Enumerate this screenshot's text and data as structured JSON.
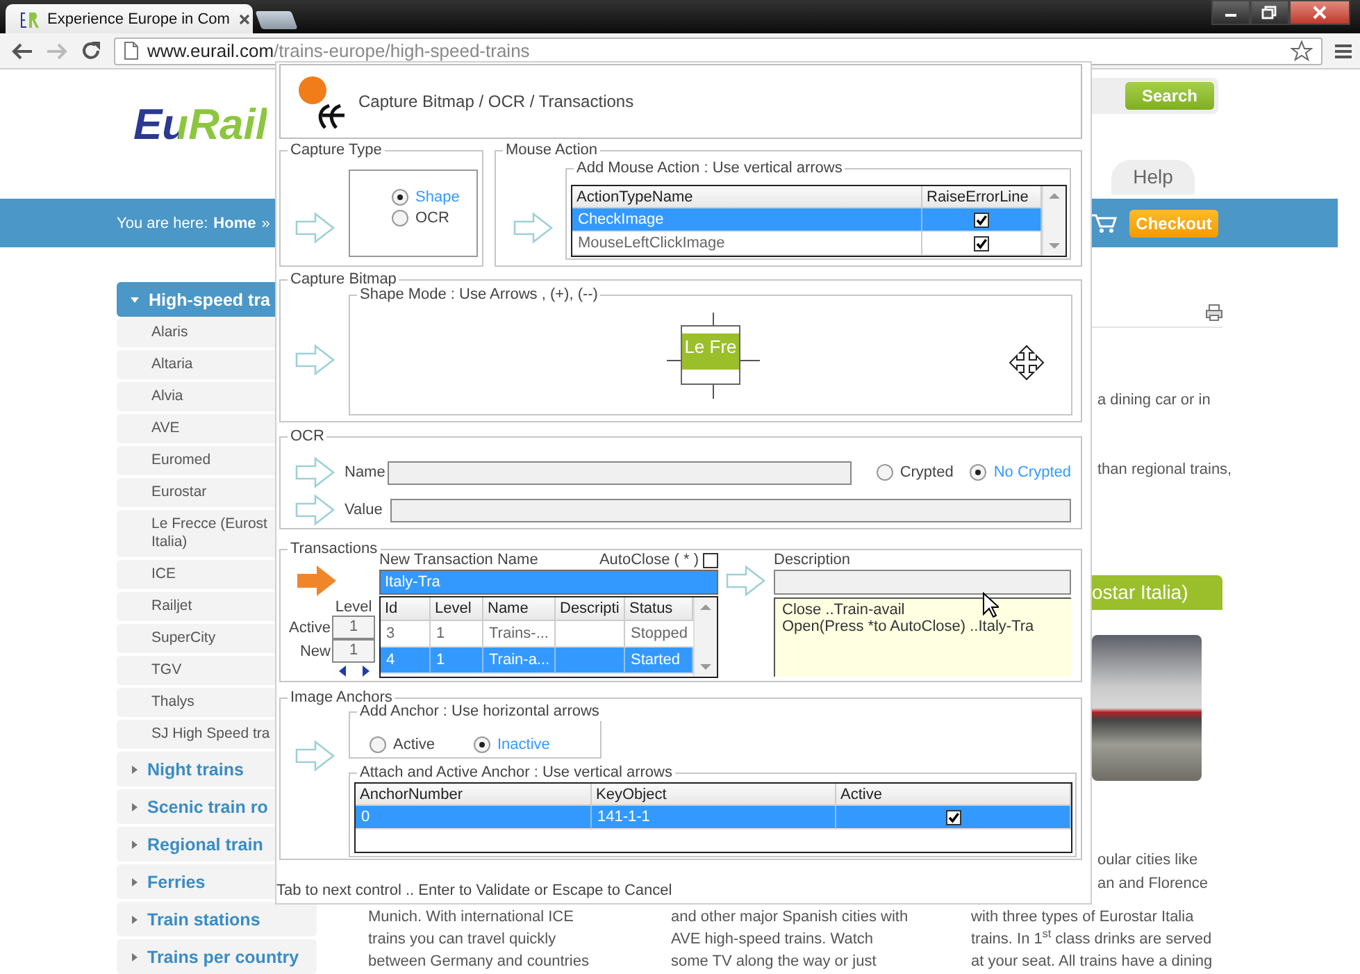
{
  "browser": {
    "tab_title": "Experience Europe in Com",
    "url_host": "www.eurail.com",
    "url_path": "/trains-europe/high-speed-trains"
  },
  "page": {
    "logo": "EuRail",
    "search_button": "Search",
    "help_tab": "Help",
    "breadcrumb": {
      "label": "You are here:",
      "home": "Home",
      "separator": "»"
    },
    "checkout_button": "Checkout",
    "sidebar": [
      {
        "label": "High-speed tra",
        "expanded": true,
        "children": [
          {
            "label": "Alaris"
          },
          {
            "label": "Altaria"
          },
          {
            "label": "Alvia"
          },
          {
            "label": "AVE"
          },
          {
            "label": "Euromed"
          },
          {
            "label": "Eurostar"
          },
          {
            "label": "Le Frecce (Eurost\nItalia)"
          },
          {
            "label": "ICE"
          },
          {
            "label": "Railjet"
          },
          {
            "label": "SuperCity"
          },
          {
            "label": "TGV"
          },
          {
            "label": "Thalys"
          },
          {
            "label": "SJ High Speed tra"
          }
        ]
      },
      {
        "label": "Night trains",
        "expanded": false
      },
      {
        "label": "Scenic train ro",
        "expanded": false
      },
      {
        "label": "Regional train",
        "expanded": false
      },
      {
        "label": "Ferries",
        "expanded": false
      },
      {
        "label": "Train stations",
        "expanded": false
      },
      {
        "label": "Trains per country",
        "expanded": false
      }
    ],
    "fragments": [
      "a dining car or in",
      "than regional trains,"
    ],
    "banner": "ostar Italia)",
    "lower_fragments": [
      "oular cities like",
      "an and Florence"
    ],
    "columns": [
      {
        "lines": [
          "Munich.  With international ICE",
          "trains you can travel quickly",
          "between Germany and countries"
        ]
      },
      {
        "lines": [
          "and other major Spanish cities with",
          "AVE high-speed trains. Watch",
          "some TV along the way or just"
        ]
      },
      {
        "lines": [
          "with three types of  Eurostar Italia",
          "trains. In 1$^{st}$ class drinks are served",
          "at your seat. All trains have a dining"
        ]
      }
    ]
  },
  "dialog": {
    "title": "Capture Bitmap / OCR / Transactions",
    "capture_type": {
      "legend": "Capture Type",
      "options": [
        {
          "label": "Shape",
          "selected": true
        },
        {
          "label": "OCR",
          "selected": false
        }
      ]
    },
    "mouse_action": {
      "legend": "Mouse Action",
      "group": "Add Mouse Action : Use vertical arrows",
      "columns": [
        "ActionTypeName",
        "RaiseErrorLine"
      ],
      "rows": [
        {
          "name": "CheckImage",
          "raise_error_line": true,
          "selected": true
        },
        {
          "name": "MouseLeftClickImage",
          "raise_error_line": true,
          "selected": false
        }
      ]
    },
    "capture_bitmap": {
      "legend": "Capture Bitmap",
      "group": "Shape Mode : Use Arrows , (+), (--)",
      "preview_text": "Le Fre"
    },
    "ocr": {
      "legend": "OCR",
      "name_label": "Name",
      "value_label": "Value",
      "options": [
        {
          "label": "Crypted",
          "selected": false
        },
        {
          "label": "No Crypted",
          "selected": true
        }
      ]
    },
    "transactions": {
      "legend": "Transactions",
      "active": true,
      "name_label": "New Transaction Name",
      "name_value": "Italy-Tra",
      "autoclose_label": "AutoClose ( * )",
      "autoclose": false,
      "level_label": "Level",
      "active_label": "Active",
      "active_level": "1",
      "new_label": "New",
      "new_level": "1",
      "columns": [
        "Id",
        "Level",
        "Name",
        "Descripti",
        "Status"
      ],
      "rows": [
        {
          "id": "3",
          "level": "1",
          "name": "Trains-...",
          "status": "Stopped",
          "selected": false
        },
        {
          "id": "4",
          "level": "1",
          "name": "Train-a...",
          "status": "Started",
          "selected": true
        }
      ],
      "description_label": "Description",
      "log": [
        "Close ..Train-avail",
        "Open(Press *to AutoClose)  ..Italy-Tra"
      ]
    },
    "image_anchors": {
      "legend": "Image Anchors",
      "add_group": "Add Anchor  : Use horizontal arrows",
      "options": [
        {
          "label": "Active",
          "selected": false
        },
        {
          "label": "Inactive",
          "selected": true
        }
      ],
      "attach_group": "Attach and Active Anchor : Use vertical arrows",
      "columns": [
        "AnchorNumber",
        "KeyObject",
        "Active"
      ],
      "rows": [
        {
          "anchor_number": "0",
          "key_object": "141-1-1",
          "active": true,
          "selected": true
        }
      ]
    },
    "hint": "Tab to next control .. Enter to Validate or Escape to Cancel"
  }
}
